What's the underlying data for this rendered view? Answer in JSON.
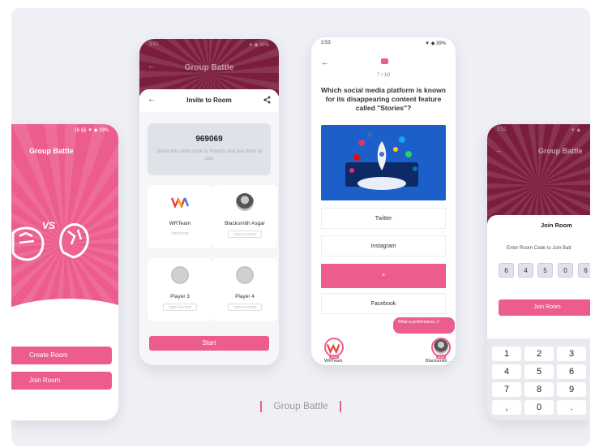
{
  "colors": {
    "accent": "#ec5c8f",
    "header": "#7b1e3e",
    "background": "#eef0f5"
  },
  "home": {
    "status": "16 §§ ▼ ◆ 39%",
    "title": "Group Battle",
    "vs": "VS",
    "create_room": "Create Room",
    "join_room": "Join Room"
  },
  "invite": {
    "status_time": "3:51",
    "status_icons": "▼ ◆ 39%",
    "header_title": "Group Battle",
    "sheet_title": "Invite to Room",
    "room_code": "969069",
    "hint": "Share this room code to Friends and ask them to Join",
    "players": [
      {
        "name": "WRTeam",
        "tag": "CREATOR",
        "avatar": "logo"
      },
      {
        "name": "Blacksmith Asgar",
        "tag": "ADD PLAYER",
        "avatar": "photo"
      },
      {
        "name": "Player 3",
        "tag": "ADD PLAYER",
        "avatar": "placeholder"
      },
      {
        "name": "Player 4",
        "tag": "ADD PLAYER",
        "avatar": "placeholder"
      }
    ],
    "start_label": "Start"
  },
  "quiz": {
    "status_time": "3:53",
    "status_icons": "▼ ◆ 39%",
    "progress_current": "7",
    "progress_total": "/ 10",
    "question": "Which social media platform is known for its disappearing content feature called \"Stories\"?",
    "options": [
      "Twitter",
      "Instagram",
      "×",
      "Facebook"
    ],
    "selected_index": 2,
    "chat_bubble": "What a performance..!!",
    "player_left": {
      "name": "WRTeam",
      "score": "2/10"
    },
    "player_right": {
      "name": "Blacksmith ...",
      "score": "3/10"
    }
  },
  "join": {
    "status_time": "3:51",
    "status_icons": "▼ ◆",
    "header_title": "Group Battle",
    "sheet_title": "Join Room",
    "enter_label": "Enter Room Code to Join Batt",
    "digits": [
      "6",
      "4",
      "5",
      "0",
      "6"
    ],
    "join_label": "Join Room",
    "keys": [
      "1",
      "2",
      "3",
      "4",
      "5",
      "6",
      "7",
      "8",
      "9",
      ",",
      "0",
      "."
    ]
  },
  "caption": "Group Battle"
}
